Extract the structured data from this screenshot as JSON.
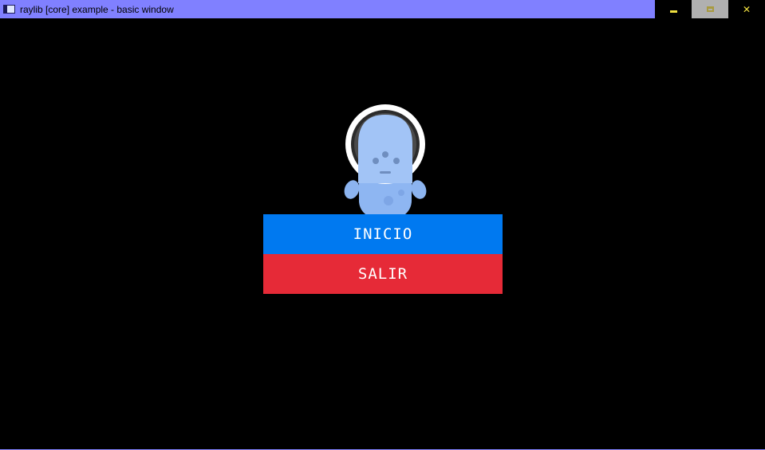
{
  "window": {
    "title": "raylib [core] example - basic window",
    "icon": "raylib-app-icon",
    "controls": {
      "minimize": "minimize-icon",
      "maximize": "maximize-icon",
      "close_glyph": "✕"
    },
    "colors": {
      "titlebar": "#8080ff",
      "background": "#000000"
    }
  },
  "menu": {
    "mascot_icon": "astronaut-mascot",
    "buttons": [
      {
        "label": "INICIO",
        "color": "#0079f0"
      },
      {
        "label": "SALIR",
        "color": "#e62a37"
      }
    ]
  }
}
